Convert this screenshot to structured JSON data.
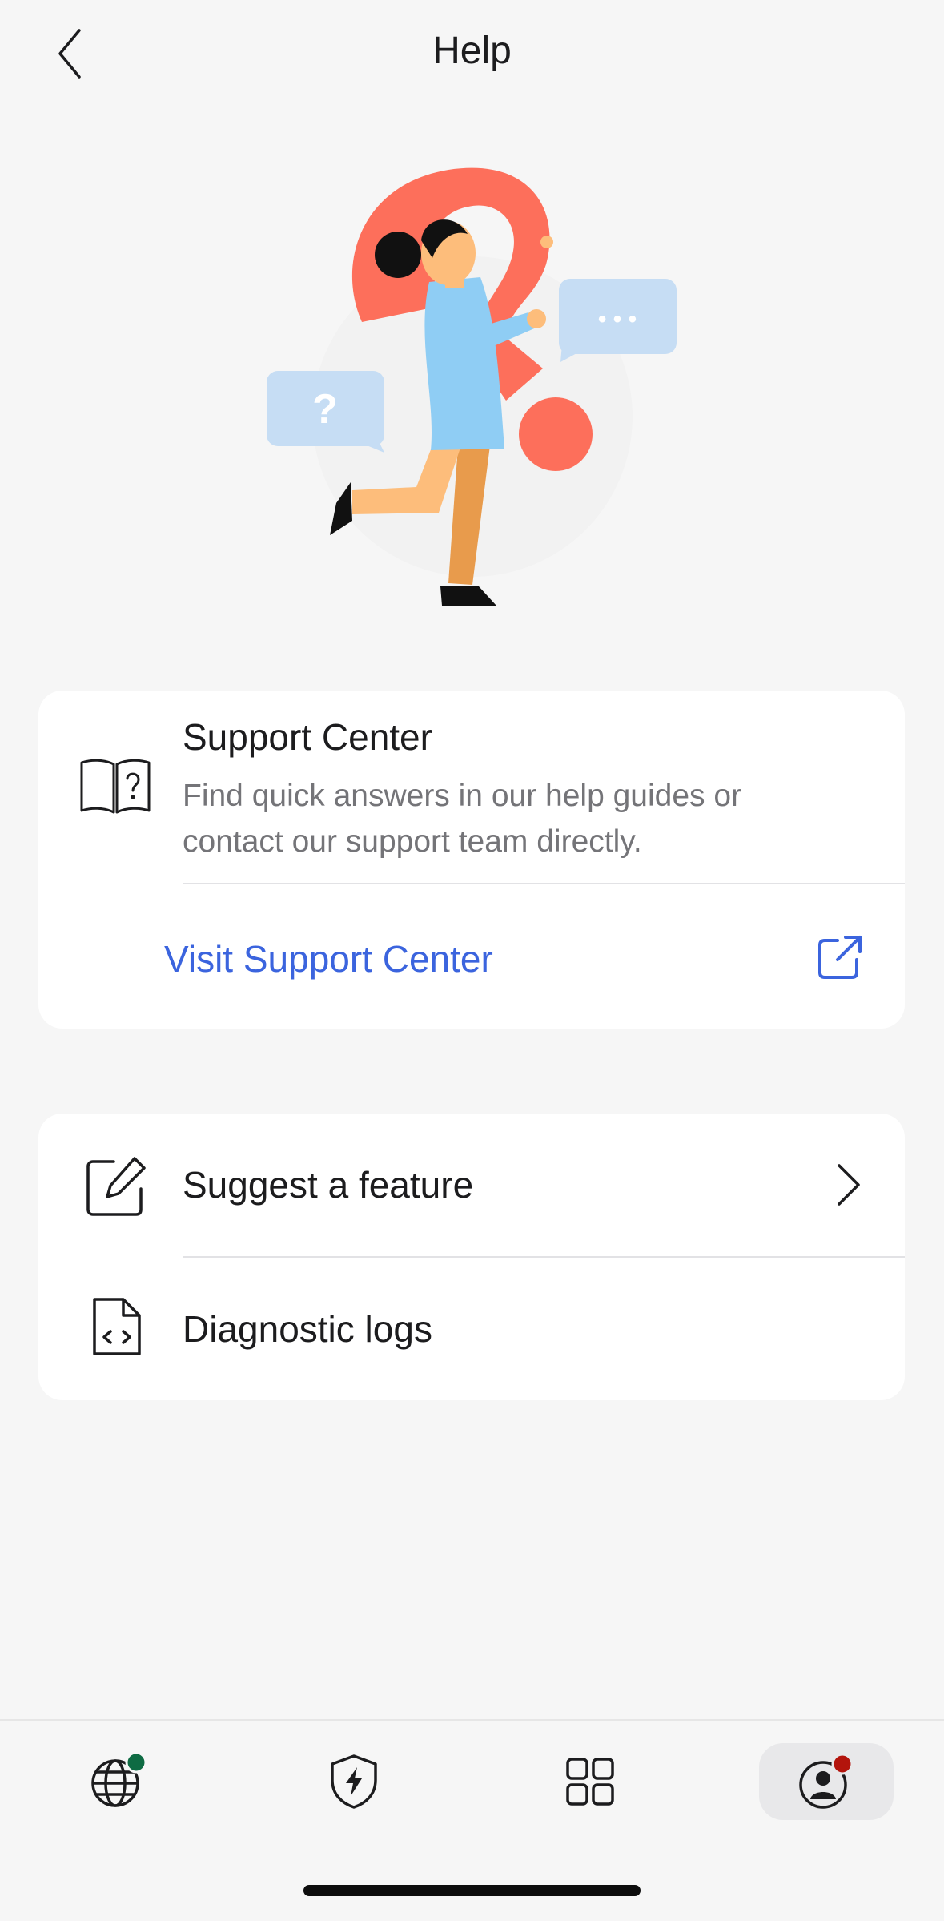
{
  "header": {
    "title": "Help"
  },
  "hero": {
    "question_mark_glyph": "?",
    "chat_dots_glyph": "• • •"
  },
  "support_card": {
    "title": "Support Center",
    "description": "Find quick answers in our help guides or contact our support team directly.",
    "link_label": "Visit Support Center"
  },
  "actions": {
    "suggest_feature": "Suggest a feature",
    "diagnostic_logs": "Diagnostic logs"
  },
  "tabbar": {
    "tabs": [
      {
        "icon": "globe-icon",
        "badge_color": "#0e6b43",
        "active": false
      },
      {
        "icon": "shield-lightning-icon",
        "active": false
      },
      {
        "icon": "grid-icon",
        "active": false
      },
      {
        "icon": "account-icon",
        "badge_color": "#b3140c",
        "active": true
      }
    ]
  },
  "colors": {
    "accent": "#3b64de",
    "background": "#f6f6f6",
    "card": "#ffffff",
    "hero_red": "#fd6f5b",
    "hero_blue": "#8fcdf4",
    "bubble_blue": "#c6ddf4"
  }
}
